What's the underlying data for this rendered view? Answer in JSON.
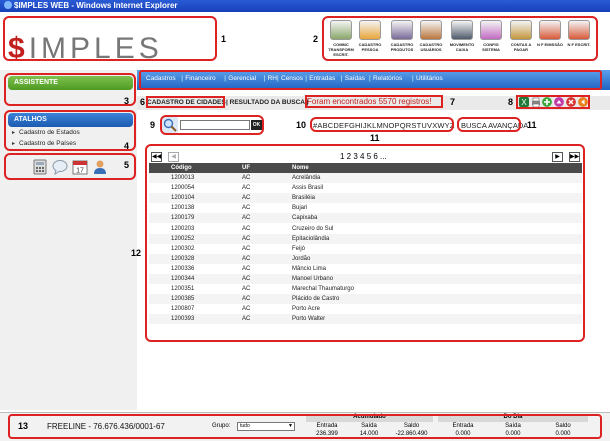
{
  "window": {
    "title": "$IMPLES WEB - Windows Internet Explorer"
  },
  "logo": {
    "dollar": "$",
    "text": "IMPLES"
  },
  "modules": [
    {
      "label": "COMMC TRANSFORM ESCRIT.",
      "icon": "transfer-icon",
      "color": "#8aa86a"
    },
    {
      "label": "CADASTRO PESSOA",
      "icon": "person-icon",
      "color": "#e8a63a"
    },
    {
      "label": "CADASTRO PRODUTOS",
      "icon": "products-icon",
      "color": "#7a6a9a"
    },
    {
      "label": "CADASTRO USUÁRIOS",
      "icon": "users-icon",
      "color": "#b9773d"
    },
    {
      "label": "MOVIMENTO CAIXA",
      "icon": "cash-icon",
      "color": "#4f5c6c"
    },
    {
      "label": "CONFIG SISTEMA",
      "icon": "config-icon",
      "color": "#c26bc2"
    },
    {
      "label": "CONTAS A PAGAR",
      "icon": "money-bag-icon",
      "color": "#c2963d"
    },
    {
      "label": "N F EMISSÃO",
      "icon": "invoice-icon",
      "color": "#d85a3a"
    },
    {
      "label": "N F ESCRIT.",
      "icon": "invoice-escrit-icon",
      "color": "#d85a3a"
    }
  ],
  "sidebar": {
    "assistente": "ASSISTENTE",
    "atalhos": "ATALHOS",
    "shortcuts": [
      "Cadastro de Estados",
      "Cadastro de Países"
    ]
  },
  "menu": [
    "Cadastros",
    "Financeiro",
    "Gerencial",
    "RH",
    "Censos",
    "Entradas",
    "Saídas",
    "Relatórios",
    "Utilitários"
  ],
  "breadcrumb": {
    "current": "CADASTRO DE CIDADES",
    "result": "| RESULTADO DA BUSCA |",
    "found": "Foram encontrados 5570 registros!"
  },
  "search": {
    "placeholder": "",
    "ok": "OK"
  },
  "alphabet": "#ABCDEFGHIJKLMNOPQRSTUVXWYZ",
  "advanced_search": "BUSCA AVANÇADA",
  "pager": {
    "first": "◀◀",
    "prev": "◀",
    "pages": "1 2 3 4 5 6 ...",
    "next": "▶",
    "last": "▶▶"
  },
  "table": {
    "headers": [
      "Código",
      "UF",
      "Nome"
    ],
    "rows": [
      [
        "1200013",
        "AC",
        "Acrelândia"
      ],
      [
        "1200054",
        "AC",
        "Assis Brasil"
      ],
      [
        "1200104",
        "AC",
        "Brasiléia"
      ],
      [
        "1200138",
        "AC",
        "Bujari"
      ],
      [
        "1200179",
        "AC",
        "Capixaba"
      ],
      [
        "1200203",
        "AC",
        "Cruzeiro do Sul"
      ],
      [
        "1200252",
        "AC",
        "Epitaciolândia"
      ],
      [
        "1200302",
        "AC",
        "Feijó"
      ],
      [
        "1200328",
        "AC",
        "Jordão"
      ],
      [
        "1200336",
        "AC",
        "Mâncio Lima"
      ],
      [
        "1200344",
        "AC",
        "Manoel Urbano"
      ],
      [
        "1200351",
        "AC",
        "Marechal Thaumaturgo"
      ],
      [
        "1200385",
        "AC",
        "Plácido de Castro"
      ],
      [
        "1200807",
        "AC",
        "Porto Acre"
      ],
      [
        "1200393",
        "AC",
        "Porto Walter"
      ]
    ]
  },
  "footer": {
    "company": "FREELINE - 76.676.436/0001-67",
    "grupo_label": "Grupo:",
    "grupo_value": "tudo",
    "acumulado": {
      "title": "Acumulado",
      "entrada_label": "Entrada",
      "saida_label": "Saída",
      "saldo_label": "Saldo",
      "entrada": "236.399",
      "saida": "14.000",
      "saldo": "-22.860.490"
    },
    "do_dia": {
      "title": "Do Dia",
      "entrada_label": "Entrada",
      "saida_label": "Saída",
      "saldo_label": "Saldo",
      "entrada": "0.000",
      "saida": "0.000",
      "saldo": "0.000"
    }
  },
  "annotations": [
    "1",
    "2",
    "3",
    "4",
    "5",
    "6",
    "7",
    "8",
    "9",
    "10",
    "11",
    "11",
    "12",
    "13"
  ]
}
